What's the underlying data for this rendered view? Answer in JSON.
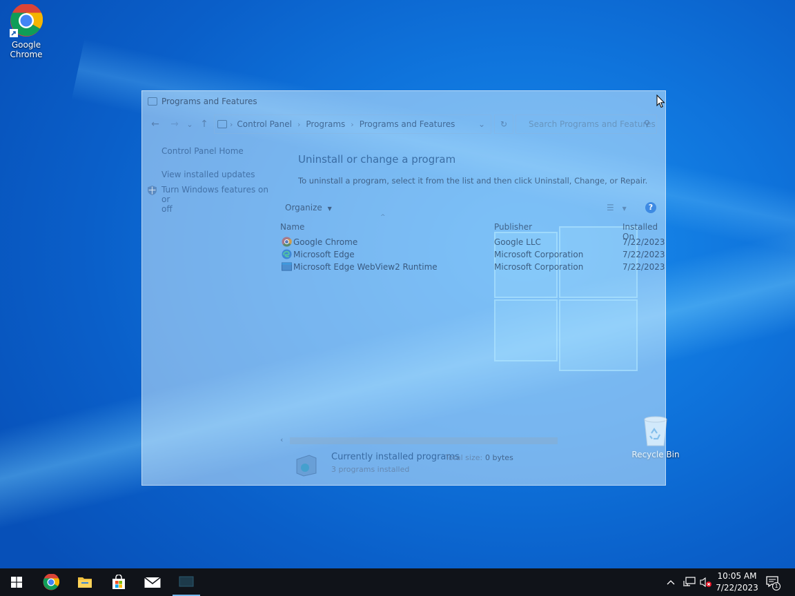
{
  "desktop": {
    "icons": [
      {
        "label_line1": "Google",
        "label_line2": "Chrome",
        "icon": "chrome-icon"
      },
      {
        "label": "Recycle Bin",
        "icon": "recycle-bin-icon"
      }
    ]
  },
  "window": {
    "title": "Programs and Features",
    "nav": {
      "back": "←",
      "forward": "→",
      "recent": "⌄",
      "up": "↑"
    },
    "breadcrumb": [
      "Control Panel",
      "Programs",
      "Programs and Features"
    ],
    "search_placeholder": "Search Programs and Features",
    "left_pane": {
      "home": "Control Panel Home",
      "updates": "View installed updates",
      "features_line1": "Turn Windows features on or",
      "features_line2": "off"
    },
    "heading": "Uninstall or change a program",
    "subheading": "To uninstall a program, select it from the list and then click Uninstall, Change, or Repair.",
    "organize": "Organize",
    "help": "?",
    "columns": {
      "name": "Name",
      "publisher": "Publisher",
      "installed_on": "Installed On"
    },
    "programs": [
      {
        "name": "Google Chrome",
        "publisher": "Google LLC",
        "installed_on": "7/22/2023",
        "icon": "chrome-icon"
      },
      {
        "name": "Microsoft Edge",
        "publisher": "Microsoft Corporation",
        "installed_on": "7/22/2023",
        "icon": "edge-icon"
      },
      {
        "name": "Microsoft Edge WebView2 Runtime",
        "publisher": "Microsoft Corporation",
        "installed_on": "7/22/2023",
        "icon": "webview-icon"
      }
    ],
    "details": {
      "title": "Currently installed programs",
      "total_label": "Total size:",
      "total_value": "0 bytes",
      "count": "3 programs installed"
    }
  },
  "taskbar": {
    "pinned": [
      "start-button",
      "chrome",
      "file-explorer",
      "store",
      "mail",
      "control-panel"
    ],
    "clock": {
      "time": "10:05 AM",
      "date": "7/22/2023"
    },
    "notification_count": "1",
    "colors": {
      "taskbar": "#101319",
      "accent": "#76b9ed"
    }
  }
}
